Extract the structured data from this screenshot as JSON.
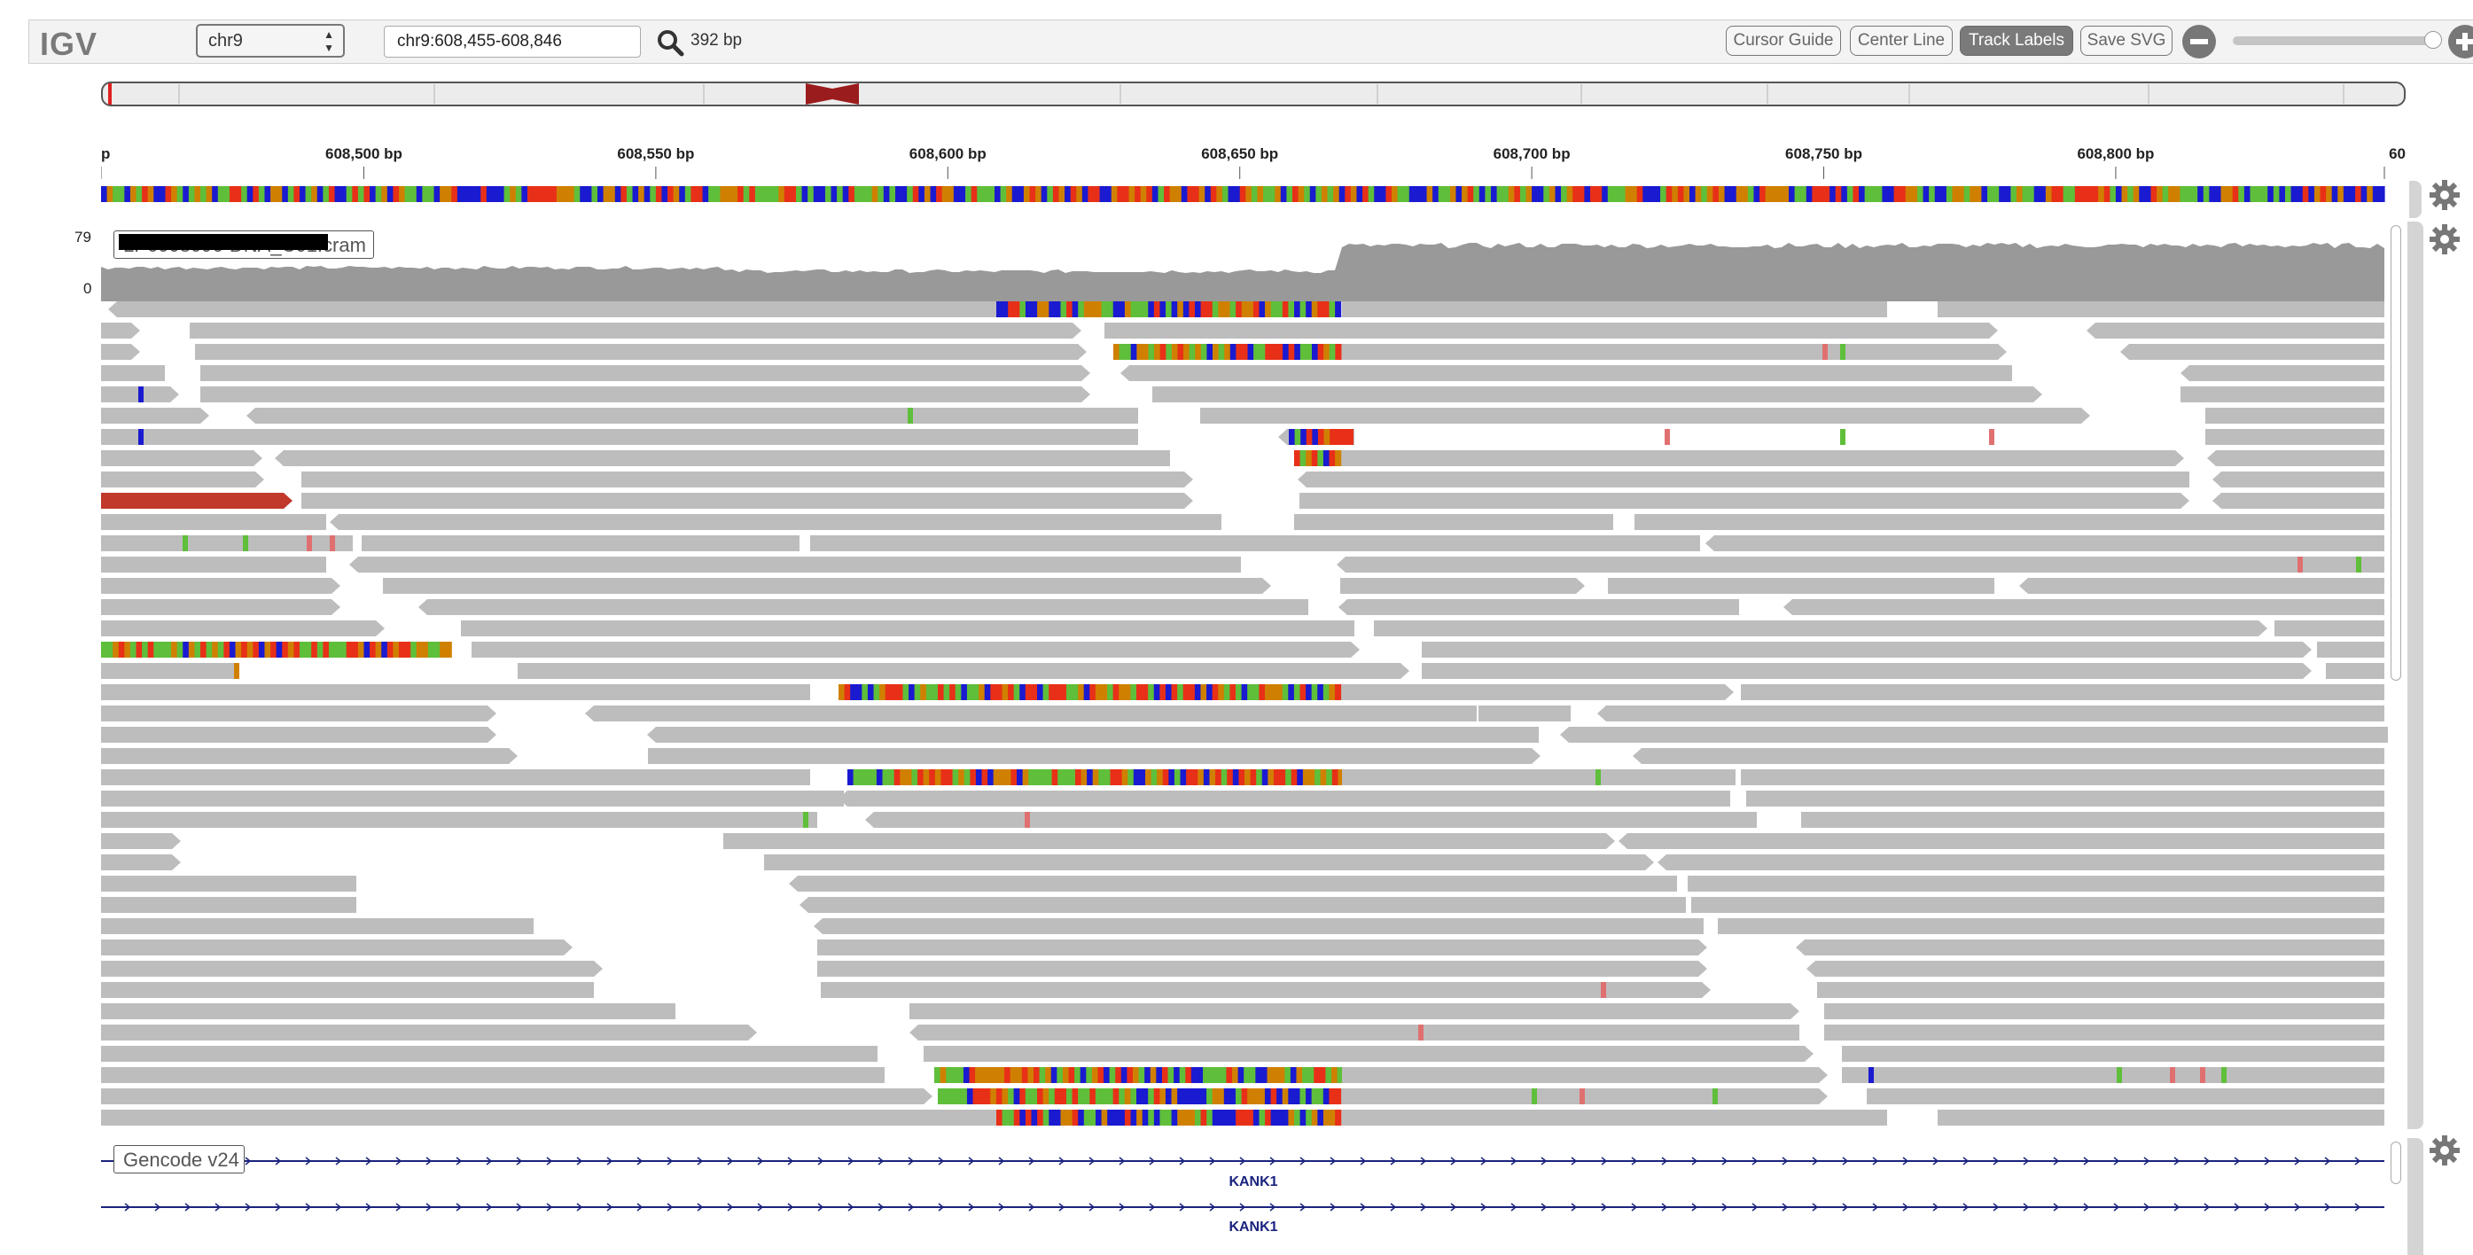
{
  "app": {
    "logo": "IGV",
    "chromosome": "chr9",
    "locus": "chr9:608,455-608,846",
    "width_label": "392 bp"
  },
  "toolbar": {
    "cursor_guide": "Cursor Guide",
    "center_line": "Center Line",
    "track_labels": "Track Labels",
    "save_svg": "Save SVG"
  },
  "icons": {
    "search": "search-icon",
    "zoom_out": "minus-circle-icon",
    "zoom_in": "plus-circle-icon",
    "settings": "gear-icon"
  },
  "ruler": {
    "ticks": [
      {
        "label": "p",
        "pos": 608455
      },
      {
        "label": "608,500 bp",
        "pos": 608500
      },
      {
        "label": "608,550 bp",
        "pos": 608550
      },
      {
        "label": "608,600 bp",
        "pos": 608600
      },
      {
        "label": "608,650 bp",
        "pos": 608650
      },
      {
        "label": "608,700 bp",
        "pos": 608700
      },
      {
        "label": "608,750 bp",
        "pos": 608750
      },
      {
        "label": "608,800 bp",
        "pos": 608800
      },
      {
        "label": "60",
        "pos": 608846
      }
    ]
  },
  "coverage": {
    "max": "79",
    "min": "0"
  },
  "tracks": {
    "alignment_label": "LP6008096-DNA_C01.cram",
    "annotation_label": "Gencode v24"
  },
  "genes": [
    {
      "name": "KANK1"
    },
    {
      "name": "KANK1"
    }
  ],
  "colors": {
    "read": "#bdbdbd",
    "coverage": "#999999",
    "base_A": "#5fbf3a",
    "base_C": "#1a1ad0",
    "base_G": "#d08000",
    "base_T": "#e83018",
    "gene": "#1a237e"
  }
}
